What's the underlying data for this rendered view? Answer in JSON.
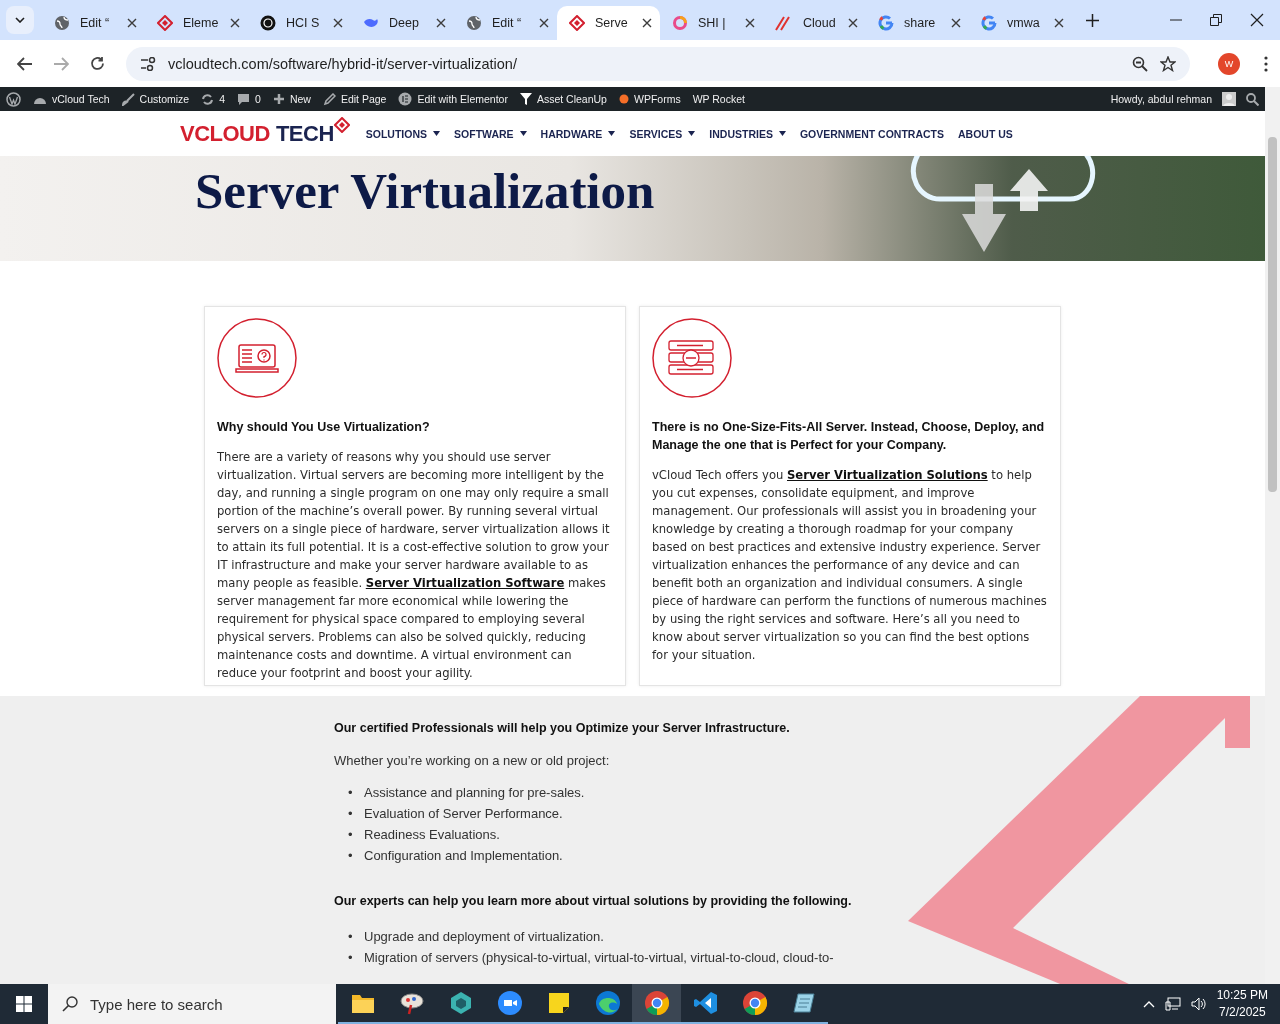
{
  "browser": {
    "tabs": [
      {
        "title": "Edit “",
        "kind": "globe",
        "selected": false
      },
      {
        "title": "Eleme",
        "kind": "diamond",
        "selected": false
      },
      {
        "title": "HCI S",
        "kind": "dark",
        "selected": false
      },
      {
        "title": "Deep",
        "kind": "whale",
        "selected": false
      },
      {
        "title": "Edit “",
        "kind": "globe",
        "selected": false
      },
      {
        "title": "Serve",
        "kind": "diamond",
        "selected": true
      },
      {
        "title": "SHI |",
        "kind": "ring",
        "selected": false
      },
      {
        "title": "Cloud",
        "kind": "swoosh",
        "selected": false
      },
      {
        "title": "share",
        "kind": "google",
        "selected": false
      },
      {
        "title": "vmwa",
        "kind": "google",
        "selected": false
      }
    ],
    "url": "vcloudtech.com/software/hybrid-it/server-virtualization/",
    "profile_initial": "W"
  },
  "admin_bar": {
    "items": [
      {
        "label": "vCloud Tech",
        "kind": "gauge"
      },
      {
        "label": "Customize",
        "kind": "brush"
      },
      {
        "label": "4",
        "kind": "refresh"
      },
      {
        "label": "0",
        "kind": "comment"
      },
      {
        "label": "New",
        "kind": "plus"
      },
      {
        "label": "Edit Page",
        "kind": "pencil"
      },
      {
        "label": "Edit with Elementor",
        "kind": "elementor"
      },
      {
        "label": "Asset CleanUp",
        "kind": "funnel"
      },
      {
        "label": "WPForms",
        "kind": "dot"
      },
      {
        "label": "WP Rocket",
        "kind": "none"
      }
    ],
    "greeting": "Howdy, abdul rehman"
  },
  "site_nav": {
    "logo_main": "VCLOUD",
    "logo_second": "TECH",
    "items": [
      {
        "label": "SOLUTIONS",
        "dropdown": true
      },
      {
        "label": "SOFTWARE",
        "dropdown": true
      },
      {
        "label": "HARDWARE",
        "dropdown": true
      },
      {
        "label": "SERVICES",
        "dropdown": true
      },
      {
        "label": "INDUSTRIES",
        "dropdown": true
      },
      {
        "label": "GOVERNMENT CONTRACTS",
        "dropdown": false
      },
      {
        "label": "ABOUT US",
        "dropdown": false
      }
    ]
  },
  "hero": {
    "title": "Server Virtualization"
  },
  "cards": [
    {
      "kind": "laptop",
      "title": "Why should You Use Virtualization?",
      "body_before": "There are a variety of reasons why you should use server virtualization. Virtual servers are becoming more intelligent by the day, and running a single program on one may only require a small portion of the machine’s overall power. By running several virtual servers on a single piece of hardware, server virtualization allows it to attain its full potential. It is a cost-effective solution to grow your IT infrastructure and make your server hardware available to as many people as feasible.",
      "link": "Server Virtualization Software",
      "body_after": "makes server management far more economical while lowering the requirement for physical space compared to employing several physical servers. Problems can also be solved quickly, reducing maintenance costs and downtime. A virtual environment can reduce your footprint and boost your agility."
    },
    {
      "kind": "servers",
      "title": "There is no One-Size-Fits-All Server. Instead, Choose, Deploy, and Manage the one that is Perfect for your Company.",
      "body_before": "vCloud Tech offers you",
      "link": "Server Virtualization Solutions",
      "body_after": "to help you cut expenses, consolidate equipment, and improve management. Our professionals will assist you in broadening your knowledge by creating a thorough roadmap for your company based on best practices and extensive industry experience. Server virtualization enhances the performance of any device and can benefit both an organization and individual consumers. A single piece of hardware can perform the functions of numerous machines by using the right services and software. Here’s all you need to know about server virtualization so you can find the best options for your situation."
    }
  ],
  "services": {
    "bullet": "•",
    "heading": "Our certified Professionals will help you Optimize your Server Infrastructure.",
    "intro": "Whether you’re working on a new or old project:",
    "list": [
      "Assistance and planning for pre-sales.",
      "Evaluation of Server Performance.",
      "Readiness Evaluations.",
      "Configuration and Implementation."
    ],
    "heading_2": "Our experts can help you learn more about virtual solutions by providing the following.",
    "list_2": [
      "Upgrade and deployment of virtualization.",
      "Migration of servers (physical-to-virtual, virtual-to-virtual, virtual-to-cloud, cloud-to-"
    ]
  },
  "taskbar": {
    "search_placeholder": "Type here to search",
    "apps": [
      {
        "kind": "folder",
        "selected": false
      },
      {
        "kind": "paint",
        "selected": false
      },
      {
        "kind": "hexagon",
        "selected": false
      },
      {
        "kind": "zoom",
        "selected": false
      },
      {
        "kind": "note",
        "selected": false
      },
      {
        "kind": "edge",
        "selected": false
      },
      {
        "kind": "chrome",
        "selected": true
      },
      {
        "kind": "code",
        "selected": false
      },
      {
        "kind": "chrome",
        "selected": false
      },
      {
        "kind": "pad",
        "selected": false
      }
    ],
    "time": "10:25 PM",
    "date": "7/2/2025"
  }
}
